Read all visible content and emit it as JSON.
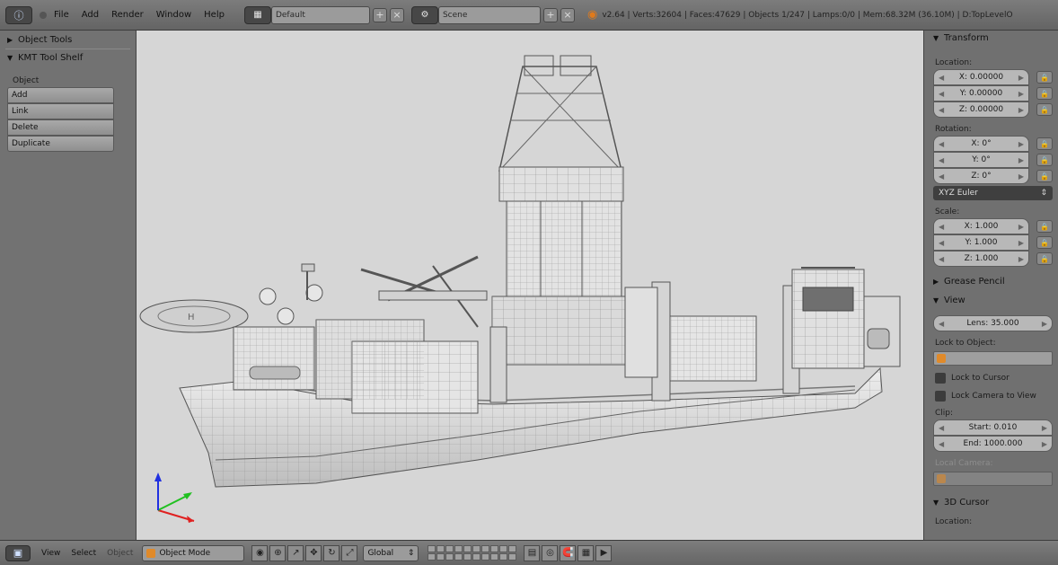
{
  "topbar": {
    "menus": [
      "File",
      "Add",
      "Render",
      "Window",
      "Help"
    ],
    "layout": "Default",
    "scene": "Scene",
    "stats": "v2.64 | Verts:32604 | Faces:47629 | Objects 1/247 | Lamps:0/0 | Mem:68.32M (36.10M) | D:TopLevelO"
  },
  "toolshelf": {
    "object_tools": "Object Tools",
    "kmt": "KMT Tool Shelf",
    "object_label": "Object",
    "buttons": [
      "Add",
      "Link",
      "Delete",
      "Duplicate"
    ]
  },
  "props": {
    "transform": "Transform",
    "location_label": "Location:",
    "location": [
      "X: 0.00000",
      "Y: 0.00000",
      "Z: 0.00000"
    ],
    "rotation_label": "Rotation:",
    "rotation": [
      "X: 0°",
      "Y: 0°",
      "Z: 0°"
    ],
    "rotation_mode": "XYZ Euler",
    "scale_label": "Scale:",
    "scale": [
      "X: 1.000",
      "Y: 1.000",
      "Z: 1.000"
    ],
    "grease_pencil": "Grease Pencil",
    "view": "View",
    "lens": "Lens: 35.000",
    "lock_to_object": "Lock to Object:",
    "lock_to_cursor": "Lock to Cursor",
    "lock_camera": "Lock Camera to View",
    "clip_label": "Clip:",
    "clip_start": "Start: 0.010",
    "clip_end": "End: 1000.000",
    "local_camera": "Local Camera:",
    "cursor_3d": "3D Cursor",
    "cursor_location": "Location:"
  },
  "bottombar": {
    "view": "View",
    "select": "Select",
    "object": "Object",
    "mode": "Object Mode",
    "orientation": "Global"
  },
  "colors": {
    "viewport_bg": "#d6d6d6",
    "axis_x": "#e02020",
    "axis_y": "#20c020",
    "axis_z": "#2030e0"
  }
}
